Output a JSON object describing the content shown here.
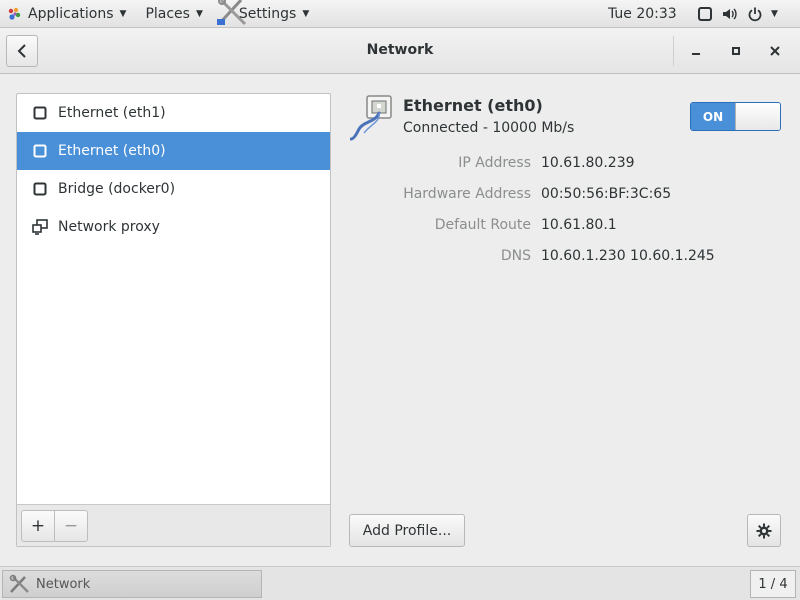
{
  "topbar": {
    "applications": "Applications",
    "places": "Places",
    "settings": "Settings",
    "clock": "Tue 20:33",
    "tray_icons": [
      "screen-icon",
      "volume-icon",
      "power-icon"
    ]
  },
  "window": {
    "title": "Network",
    "controls": [
      "minimize",
      "maximize",
      "close"
    ]
  },
  "sidebar": {
    "items": [
      {
        "label": "Ethernet (eth1)",
        "icon": "ethernet-icon",
        "selected": false
      },
      {
        "label": "Ethernet (eth0)",
        "icon": "ethernet-icon",
        "selected": true
      },
      {
        "label": "Bridge (docker0)",
        "icon": "ethernet-icon",
        "selected": false
      },
      {
        "label": "Network proxy",
        "icon": "proxy-icon",
        "selected": false
      }
    ],
    "add_label": "+",
    "remove_label": "−"
  },
  "device": {
    "name": "Ethernet (eth0)",
    "status": "Connected - 10000 Mb/s",
    "switch_label": "ON",
    "enabled": true,
    "properties": [
      {
        "label": "IP Address",
        "value": "10.61.80.239"
      },
      {
        "label": "Hardware Address",
        "value": "00:50:56:BF:3C:65"
      },
      {
        "label": "Default Route",
        "value": "10.61.80.1"
      },
      {
        "label": "DNS",
        "value": "10.60.1.230 10.60.1.245"
      }
    ],
    "add_profile_label": "Add Profile..."
  },
  "taskbar": {
    "task_label": "Network",
    "workspace": "1 / 4"
  },
  "colors": {
    "accent": "#4a90d9",
    "label_gray": "#8b8e8f"
  }
}
